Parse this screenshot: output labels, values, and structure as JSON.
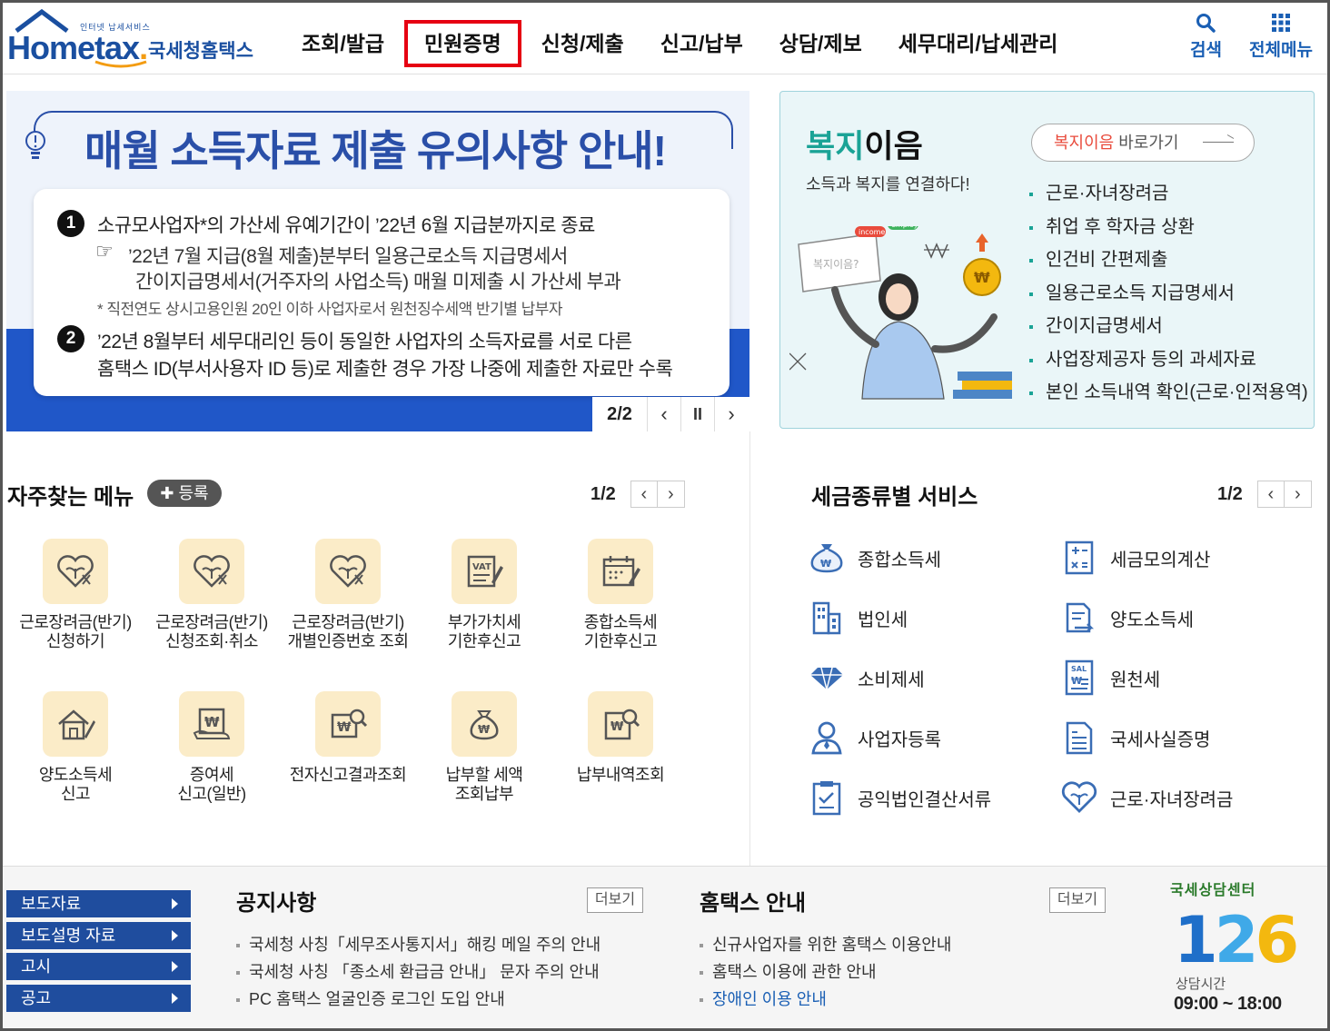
{
  "header": {
    "logo_small": "인터넷 납세서비스",
    "logo_word": "Hometax",
    "logo_korean": "국세청홈택스",
    "nav": [
      {
        "label": "조회/발급"
      },
      {
        "label": "민원증명"
      },
      {
        "label": "신청/제출"
      },
      {
        "label": "신고/납부"
      },
      {
        "label": "상담/제보"
      },
      {
        "label": "세무대리/납세관리"
      }
    ],
    "highlighted_nav_index": 1,
    "search_label": "검색",
    "allmenu_label": "전체메뉴"
  },
  "banner": {
    "title": "매월 소득자료 제출 유의사항 안내!",
    "item1_num": "1",
    "item1_main": "소규모사업자*의 가산세 유예기간이 ’22년 6월 지급분까지로 종료",
    "item1_sub1": "’22년 7월 지급(8월 제출)분부터 일용근로소득 지급명세서",
    "item1_sub2": "간이지급명세서(거주자의 사업소득) 매월 미제출 시 가산세 부과",
    "item1_note": "* 직전연도 상시고용인원 20인 이하 사업자로서 원천징수세액 반기별 납부자",
    "item2_num": "2",
    "item2_line1": "’22년 8월부터 세무대리인 등이 동일한 사업자의 소득자료를 서로 다른",
    "item2_line2": "홈택스 ID(부서사용자 ID 등)로 제출한 경우 가장 나중에 제출한 자료만 수록",
    "pager": "2/2",
    "prev": "‹",
    "pause": "II",
    "next": "›"
  },
  "welfare": {
    "title_green": "복지",
    "title_rest": "이음",
    "subtitle": "소득과 복지를 연결하다!",
    "button_red": "복지이음",
    "button_rest": " 바로가기",
    "illus_sign": "복지이음?",
    "illus_tag1": "income",
    "illus_tag2": "employ",
    "items": [
      "근로·자녀장려금",
      "취업 후 학자금 상환",
      "인건비 간편제출",
      "일용근로소득 지급명세서",
      "간이지급명세서",
      "사업장제공자 등의 과세자료",
      "본인 소득내역 확인(근로·인적용역)"
    ]
  },
  "frequent": {
    "title": "자주찾는 메뉴",
    "register": "✚ 등록",
    "pager": "1/2",
    "prev": "‹",
    "next": "›",
    "items": [
      {
        "label": "근로장려금(반기)\n신청하기",
        "icon": "heart-sprout-icon"
      },
      {
        "label": "근로장려금(반기)\n신청조회·취소",
        "icon": "heart-sprout-icon"
      },
      {
        "label": "근로장려금(반기)\n개별인증번호 조회",
        "icon": "heart-sprout-icon"
      },
      {
        "label": "부가가치세\n기한후신고",
        "icon": "vat-document-icon"
      },
      {
        "label": "종합소득세\n기한후신고",
        "icon": "calendar-pen-icon"
      },
      {
        "label": "양도소득세\n신고",
        "icon": "house-pen-icon"
      },
      {
        "label": "증여세\n신고(일반)",
        "icon": "gift-tablet-icon"
      },
      {
        "label": "전자신고결과조회",
        "icon": "won-search-icon"
      },
      {
        "label": "납부할 세액\n조회납부",
        "icon": "money-bag-icon"
      },
      {
        "label": "납부내역조회",
        "icon": "receipt-search-icon"
      }
    ]
  },
  "taxservice": {
    "title": "세금종류별 서비스",
    "pager": "1/2",
    "prev": "‹",
    "next": "›",
    "items": [
      {
        "label": "종합소득세",
        "icon": "money-bag-icon"
      },
      {
        "label": "세금모의계산",
        "icon": "calculator-icon"
      },
      {
        "label": "법인세",
        "icon": "building-icon"
      },
      {
        "label": "양도소득세",
        "icon": "document-transfer-icon"
      },
      {
        "label": "소비제세",
        "icon": "diamond-icon"
      },
      {
        "label": "원천세",
        "icon": "salary-slip-icon"
      },
      {
        "label": "사업자등록",
        "icon": "person-icon"
      },
      {
        "label": "국세사실증명",
        "icon": "certificate-icon"
      },
      {
        "label": "공익법인결산서류",
        "icon": "clipboard-check-icon"
      },
      {
        "label": "근로·자녀장려금",
        "icon": "heart-icon"
      }
    ]
  },
  "footer": {
    "side_buttons": [
      "보도자료",
      "보도설명 자료",
      "고시",
      "공고"
    ],
    "notice_title": "공지사항",
    "notice_more": "더보기",
    "notices": [
      "국세청 사칭「세무조사통지서」해킹 메일 주의 안내",
      "국세청 사칭 「종소세 환급금 안내」 문자 주의 안내",
      "PC 홈택스 얼굴인증 로그인 도입 안내"
    ],
    "guide_title": "홈택스 안내",
    "guide_more": "더보기",
    "guides": [
      "신규사업자를 위한 홈택스 이용안내",
      "홈택스 이용에 관한 안내",
      "장애인 이용 안내"
    ],
    "center_title": "국세상담센터",
    "center_num_1": "1",
    "center_num_2": "2",
    "center_num_3": "6",
    "center_hours_label": "상담시간",
    "center_hours": "09:00 ~ 18:00"
  },
  "colors": {
    "brand_blue": "#1a4fa0",
    "highlight_red": "#e60012",
    "welfare_green": "#1aa396",
    "footer_button_blue": "#1f4d9e",
    "icon_bg": "#fbecc8"
  }
}
